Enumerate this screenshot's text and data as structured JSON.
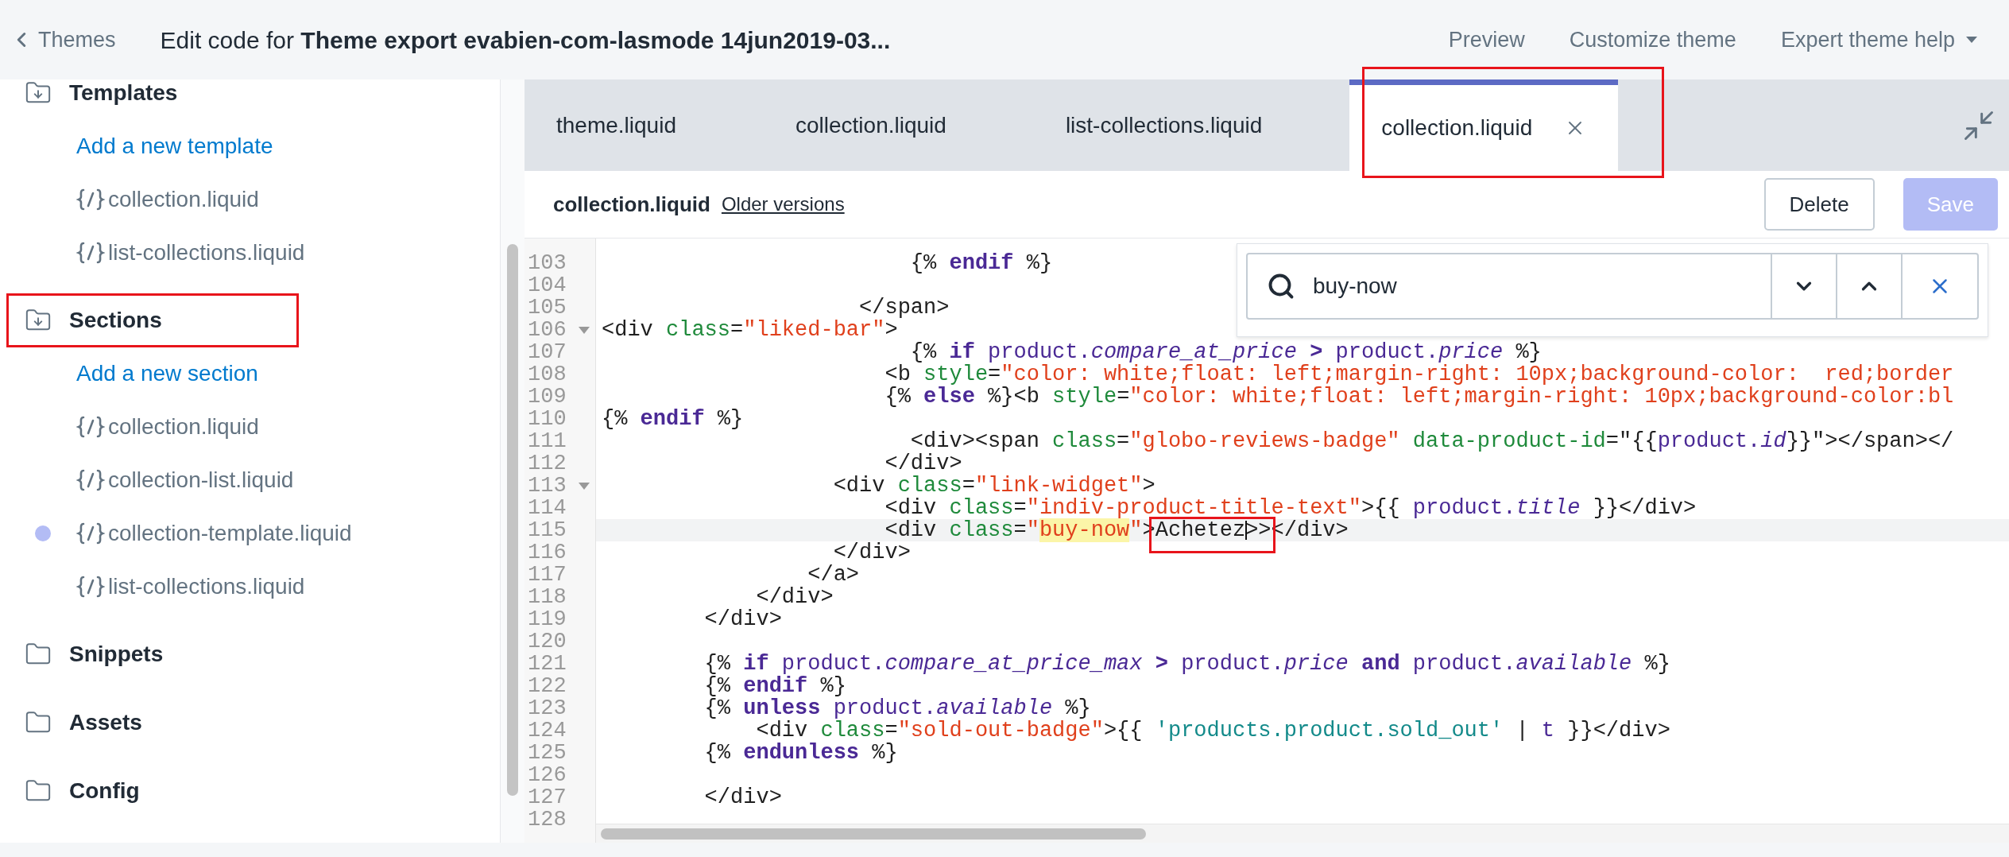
{
  "topbar": {
    "back": "Themes",
    "title": "Edit code for **Theme export evabien-com-lasmode 14jun2019-03...**",
    "actions": [
      "Preview",
      "Customize theme"
    ],
    "help_menu": "Expert theme help"
  },
  "sidebar": {
    "folders": [
      {
        "name": "Templates",
        "expanded": true,
        "annotated": false,
        "add_link": "Add a new template",
        "files": [
          {
            "name": "collection.liquid",
            "modified": false
          },
          {
            "name": "list-collections.liquid",
            "modified": false
          }
        ]
      },
      {
        "name": "Sections",
        "expanded": true,
        "annotated": true,
        "add_link": "Add a new section",
        "files": [
          {
            "name": "collection.liquid",
            "modified": false
          },
          {
            "name": "collection-list.liquid",
            "modified": false
          },
          {
            "name": "collection-template.liquid",
            "modified": true
          },
          {
            "name": "list-collections.liquid",
            "modified": false
          }
        ]
      },
      {
        "name": "Snippets",
        "expanded": false,
        "annotated": false
      },
      {
        "name": "Assets",
        "expanded": false,
        "annotated": false
      },
      {
        "name": "Config",
        "expanded": false,
        "annotated": false
      }
    ]
  },
  "tabs": [
    {
      "label": "theme.liquid",
      "selected": false,
      "closable": false,
      "annotated": false
    },
    {
      "label": "collection.liquid",
      "selected": false,
      "closable": false,
      "annotated": false
    },
    {
      "label": "list-collections.liquid",
      "selected": false,
      "closable": false,
      "annotated": false
    },
    {
      "label": "collection.liquid",
      "selected": true,
      "closable": true,
      "annotated": true
    }
  ],
  "file_header": {
    "name": "collection.liquid",
    "link": "Older versions",
    "buttons": [
      {
        "label": "Delete",
        "disabled": false
      },
      {
        "label": "Save",
        "disabled": true
      }
    ]
  },
  "search": {
    "value": "buy-now"
  },
  "editor": {
    "lines": [
      {
        "number": "103",
        "tokens": [
          {
            "kind": "plain",
            "text": "                        {% "
          },
          {
            "kind": "keyword",
            "text": "endif"
          },
          {
            "kind": "plain",
            "text": " %}"
          }
        ]
      },
      {
        "number": "104"
      },
      {
        "number": "105",
        "tokens": [
          {
            "kind": "plain",
            "text": "                    </span>"
          }
        ]
      },
      {
        "number": "106",
        "fold": true,
        "tokens": [
          {
            "kind": "plain",
            "text": "<div "
          },
          {
            "kind": "attr",
            "text": "class"
          },
          {
            "kind": "plain",
            "text": "="
          },
          {
            "kind": "string",
            "text": "\"liked-bar\""
          },
          {
            "kind": "plain",
            "text": ">"
          }
        ]
      },
      {
        "number": "107",
        "tokens": [
          {
            "kind": "plain",
            "text": "                        {% "
          },
          {
            "kind": "keyword",
            "text": "if"
          },
          {
            "kind": "variable",
            "text": " product."
          },
          {
            "kind": "property",
            "text": "compare_at_price"
          },
          {
            "kind": "operator",
            "text": " > "
          },
          {
            "kind": "variable",
            "text": "product."
          },
          {
            "kind": "property",
            "text": "price"
          },
          {
            "kind": "plain",
            "text": " %}"
          }
        ]
      },
      {
        "number": "108",
        "tokens": [
          {
            "kind": "plain",
            "text": "                      <b "
          },
          {
            "kind": "attr",
            "text": "style"
          },
          {
            "kind": "plain",
            "text": "="
          },
          {
            "kind": "string",
            "text": "\"color: white;float: left;margin-right: 10px;background-color:  red;border"
          }
        ]
      },
      {
        "number": "109",
        "tokens": [
          {
            "kind": "plain",
            "text": "                      {% "
          },
          {
            "kind": "keyword",
            "text": "else"
          },
          {
            "kind": "plain",
            "text": " %}<b "
          },
          {
            "kind": "attr",
            "text": "style"
          },
          {
            "kind": "plain",
            "text": "="
          },
          {
            "kind": "string",
            "text": "\"color: white;float: left;margin-right: 10px;background-color:bl"
          }
        ]
      },
      {
        "number": "110",
        "tokens": [
          {
            "kind": "plain",
            "text": "{% "
          },
          {
            "kind": "keyword",
            "text": "endif"
          },
          {
            "kind": "plain",
            "text": " %}"
          }
        ]
      },
      {
        "number": "111",
        "tokens": [
          {
            "kind": "plain",
            "text": "                        <div><span "
          },
          {
            "kind": "attr",
            "text": "class"
          },
          {
            "kind": "plain",
            "text": "="
          },
          {
            "kind": "string",
            "text": "\"globo-reviews-badge\""
          },
          {
            "kind": "attr",
            "text": " data-product-id"
          },
          {
            "kind": "plain",
            "text": "=\"{{"
          },
          {
            "kind": "variable",
            "text": "product."
          },
          {
            "kind": "property",
            "text": "id"
          },
          {
            "kind": "plain",
            "text": "}}\"></span></"
          }
        ]
      },
      {
        "number": "112",
        "tokens": [
          {
            "kind": "plain",
            "text": "                      </div>"
          }
        ]
      },
      {
        "number": "113",
        "fold": true,
        "tokens": [
          {
            "kind": "plain",
            "text": "                  <div "
          },
          {
            "kind": "attr",
            "text": "class"
          },
          {
            "kind": "plain",
            "text": "="
          },
          {
            "kind": "string",
            "text": "\"link-widget\""
          },
          {
            "kind": "plain",
            "text": ">"
          }
        ]
      },
      {
        "number": "114",
        "tokens": [
          {
            "kind": "plain",
            "text": "                      <div "
          },
          {
            "kind": "attr",
            "text": "class"
          },
          {
            "kind": "plain",
            "text": "="
          },
          {
            "kind": "string",
            "text": "\"indiv-product-title-text\""
          },
          {
            "kind": "plain",
            "text": ">{{ "
          },
          {
            "kind": "variable",
            "text": "product."
          },
          {
            "kind": "property",
            "text": "title"
          },
          {
            "kind": "plain",
            "text": " }}</div>"
          }
        ]
      },
      {
        "number": "115",
        "current": true,
        "tokens": [
          {
            "kind": "plain",
            "text": "                      <div "
          },
          {
            "kind": "attr",
            "text": "class"
          },
          {
            "kind": "plain",
            "text": "="
          },
          {
            "kind": "string",
            "text": "\""
          },
          {
            "kind": "match",
            "text": "buy-now"
          },
          {
            "kind": "string",
            "text": "\""
          },
          {
            "kind": "plain",
            "text": ">"
          },
          {
            "kind": "plain",
            "text": "Achetez",
            "annotated": true,
            "caret_after": true
          },
          {
            "kind": "plain",
            "text": ">></div>"
          }
        ]
      },
      {
        "number": "116",
        "tokens": [
          {
            "kind": "plain",
            "text": "                  </div>"
          }
        ]
      },
      {
        "number": "117",
        "tokens": [
          {
            "kind": "plain",
            "text": "                </a>"
          }
        ]
      },
      {
        "number": "118",
        "tokens": [
          {
            "kind": "plain",
            "text": "            </div>"
          }
        ]
      },
      {
        "number": "119",
        "tokens": [
          {
            "kind": "plain",
            "text": "        </div>"
          }
        ]
      },
      {
        "number": "120"
      },
      {
        "number": "121",
        "tokens": [
          {
            "kind": "plain",
            "text": "        {% "
          },
          {
            "kind": "keyword",
            "text": "if"
          },
          {
            "kind": "variable",
            "text": " product."
          },
          {
            "kind": "property",
            "text": "compare_at_price_max"
          },
          {
            "kind": "operator",
            "text": " > "
          },
          {
            "kind": "variable",
            "text": "product."
          },
          {
            "kind": "property",
            "text": "price"
          },
          {
            "kind": "keyword",
            "text": " and "
          },
          {
            "kind": "variable",
            "text": "product."
          },
          {
            "kind": "property",
            "text": "available"
          },
          {
            "kind": "plain",
            "text": " %}"
          }
        ]
      },
      {
        "number": "122",
        "tokens": [
          {
            "kind": "plain",
            "text": "        {% "
          },
          {
            "kind": "keyword",
            "text": "endif"
          },
          {
            "kind": "plain",
            "text": " %}"
          }
        ]
      },
      {
        "number": "123",
        "tokens": [
          {
            "kind": "plain",
            "text": "        {% "
          },
          {
            "kind": "keyword",
            "text": "unless"
          },
          {
            "kind": "variable",
            "text": " product."
          },
          {
            "kind": "property",
            "text": "available"
          },
          {
            "kind": "plain",
            "text": " %}"
          }
        ]
      },
      {
        "number": "124",
        "tokens": [
          {
            "kind": "plain",
            "text": "            <div "
          },
          {
            "kind": "attr",
            "text": "class"
          },
          {
            "kind": "plain",
            "text": "="
          },
          {
            "kind": "string",
            "text": "\"sold-out-badge\""
          },
          {
            "kind": "plain",
            "text": ">{{ "
          },
          {
            "kind": "literal",
            "text": "'products.product.sold_out'"
          },
          {
            "kind": "plain",
            "text": " | "
          },
          {
            "kind": "variable",
            "text": "t"
          },
          {
            "kind": "plain",
            "text": " }}</div>"
          }
        ]
      },
      {
        "number": "125",
        "tokens": [
          {
            "kind": "plain",
            "text": "        {% "
          },
          {
            "kind": "keyword",
            "text": "endunless"
          },
          {
            "kind": "plain",
            "text": " %}"
          }
        ]
      },
      {
        "number": "126"
      },
      {
        "number": "127",
        "tokens": [
          {
            "kind": "plain",
            "text": "        </div>"
          }
        ]
      },
      {
        "number": "128"
      }
    ]
  }
}
